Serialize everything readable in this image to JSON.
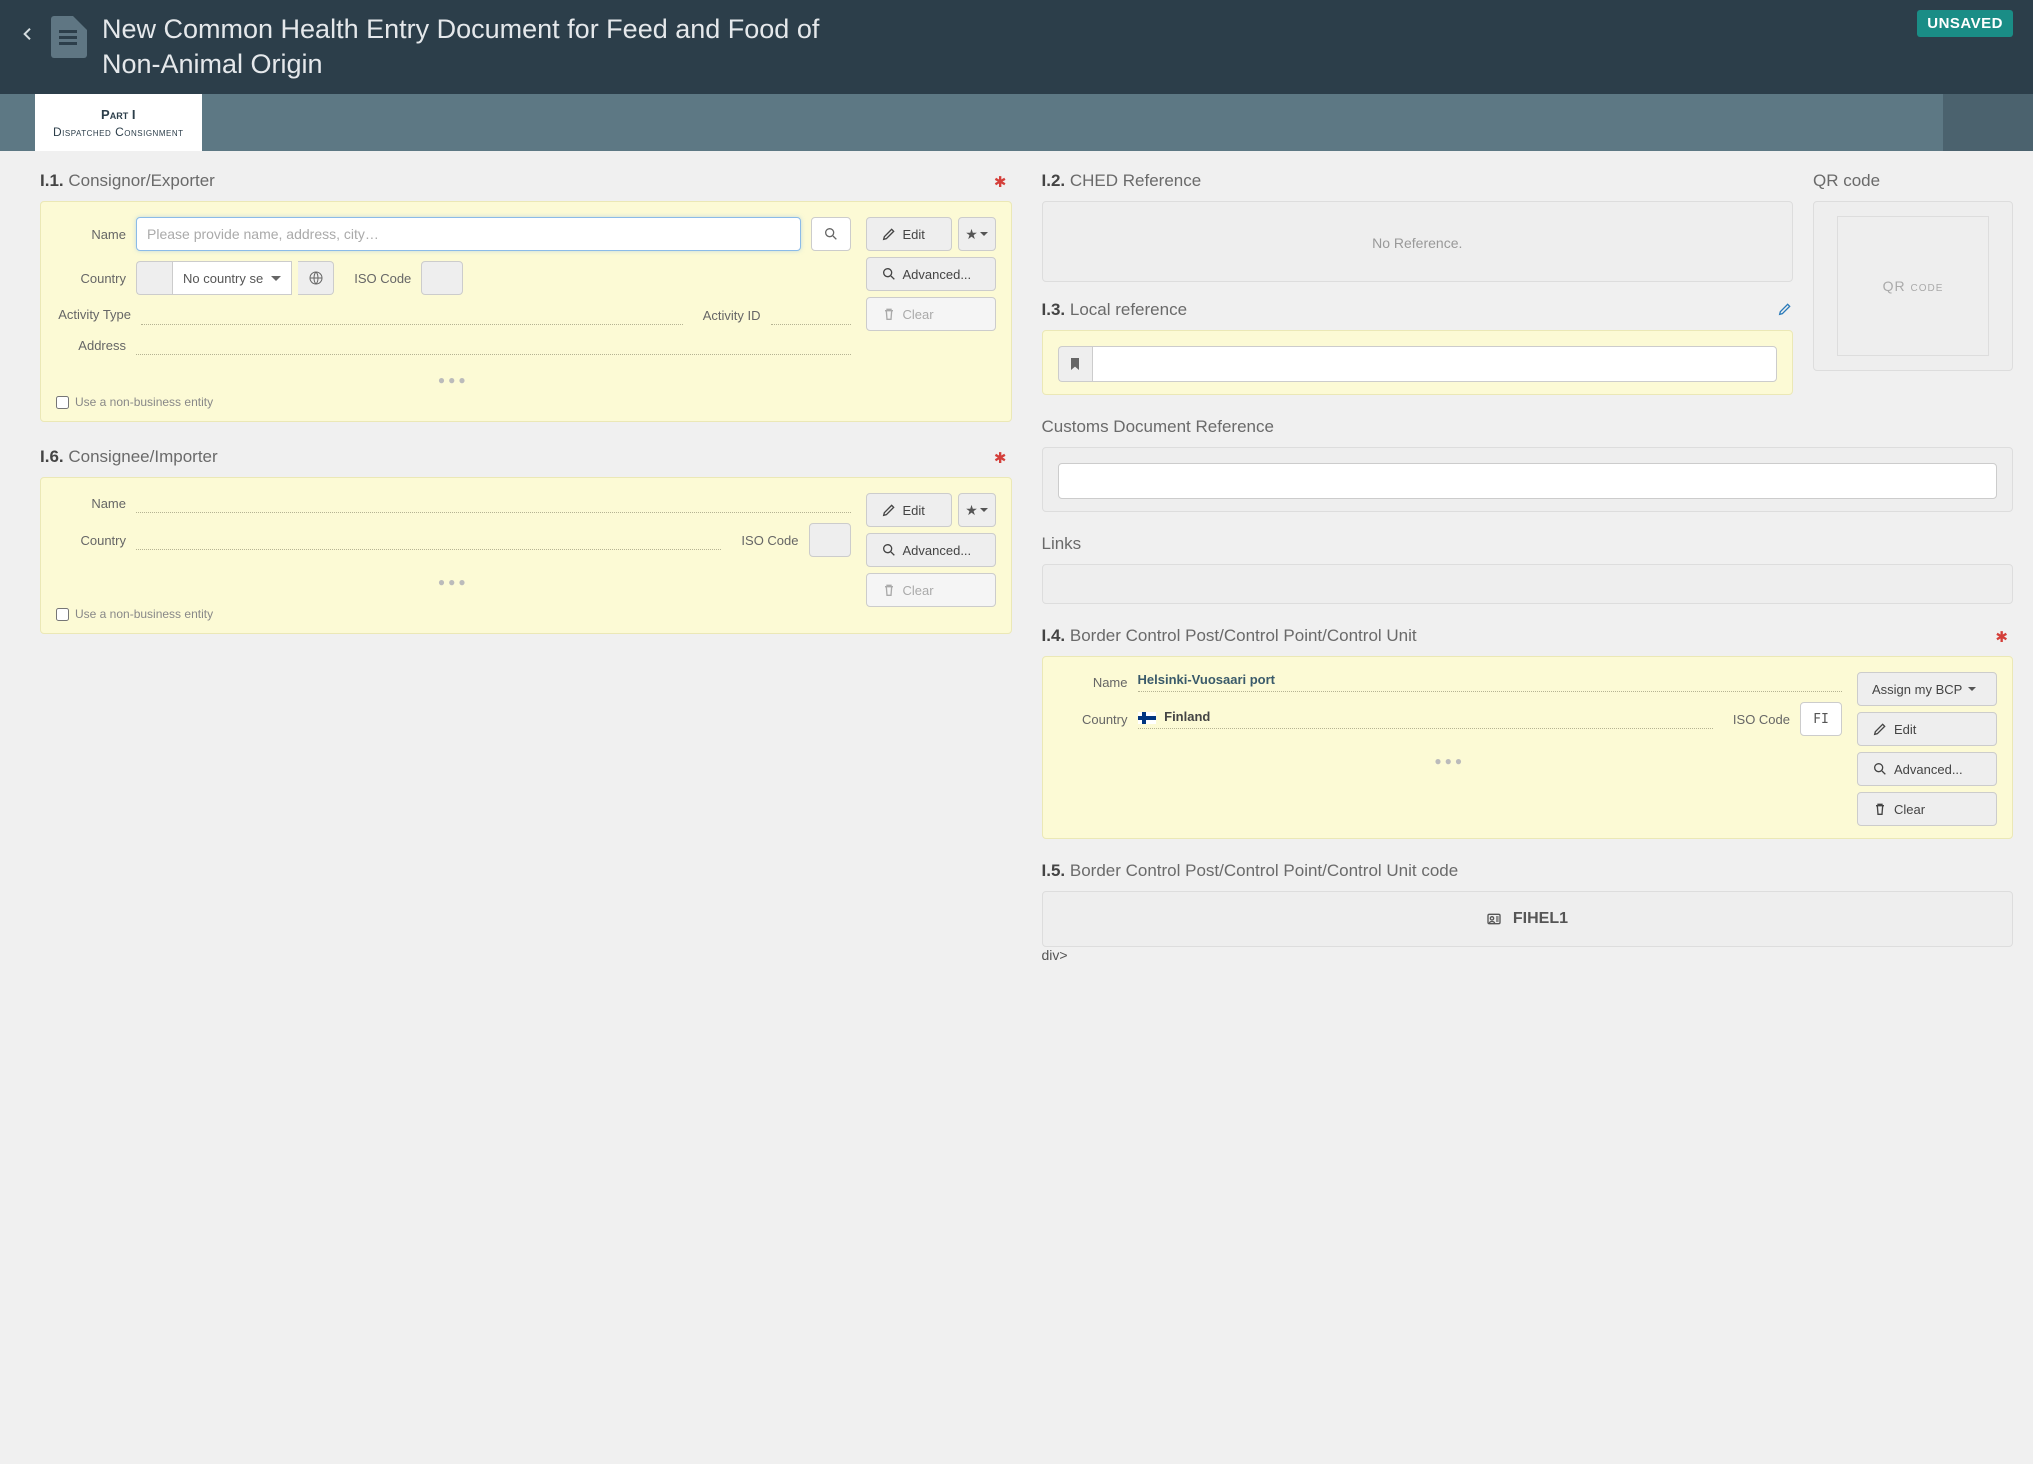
{
  "header": {
    "title": "New Common Health Entry Document for Feed and Food of Non-Animal Origin",
    "status": "UNSAVED"
  },
  "tab": {
    "title": "Part I",
    "subtitle": "Dispatched Consignment"
  },
  "labels": {
    "name": "Name",
    "country": "Country",
    "iso_code": "ISO Code",
    "activity_type": "Activity Type",
    "activity_id": "Activity ID",
    "address": "Address",
    "non_business": "Use a non-business entity"
  },
  "buttons": {
    "edit": "Edit",
    "advanced": "Advanced...",
    "clear": "Clear",
    "assign_bcp": "Assign my BCP"
  },
  "placeholders": {
    "name_search": "Please provide name, address, city…",
    "no_country": "No country se"
  },
  "i1": {
    "num": "I.1.",
    "title": "Consignor/Exporter"
  },
  "i6": {
    "num": "I.6.",
    "title": "Consignee/Importer"
  },
  "i2": {
    "num": "I.2.",
    "title": "CHED Reference",
    "no_ref": "No Reference."
  },
  "i3": {
    "num": "I.3.",
    "title": "Local reference"
  },
  "customs": {
    "title": "Customs Document Reference"
  },
  "links": {
    "title": "Links"
  },
  "i4": {
    "num": "I.4.",
    "title": "Border Control Post/Control Point/Control Unit",
    "name_value": "Helsinki-Vuosaari port",
    "country_value": "Finland",
    "iso_value": "FI"
  },
  "i5": {
    "num": "I.5.",
    "title": "Border Control Post/Control Point/Control Unit code",
    "value": "FIHEL1"
  },
  "qr": {
    "title": "QR code",
    "placeholder": "QR code"
  }
}
